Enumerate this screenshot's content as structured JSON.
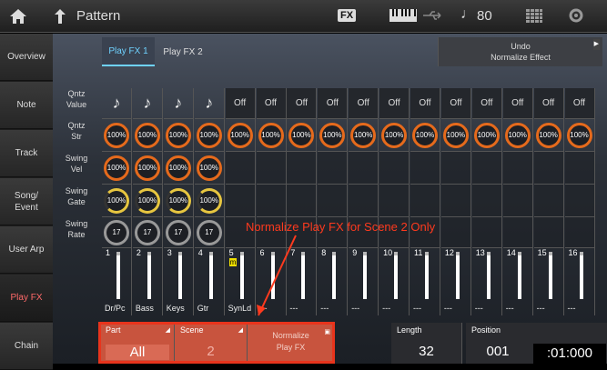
{
  "topbar": {
    "title": "Pattern",
    "fx_badge": "FX",
    "tempo_symbol": "♩",
    "tempo": "80"
  },
  "sidebar": {
    "items": [
      {
        "label": "Overview"
      },
      {
        "label": "Note"
      },
      {
        "label": "Track"
      },
      {
        "label": "Song/\nEvent"
      },
      {
        "label": "User Arp"
      },
      {
        "label": "Play FX",
        "active": true
      },
      {
        "label": "Chain"
      }
    ]
  },
  "tabs": [
    {
      "label": "Play FX 1",
      "active": true
    },
    {
      "label": "Play FX 2"
    }
  ],
  "undo": {
    "line1": "Undo",
    "line2": "Normalize Effect"
  },
  "rows": {
    "qntz_value": "Qntz\nValue",
    "qntz_str": "Qntz\nStr",
    "swing_vel": "Swing\nVel",
    "swing_gate": "Swing\nGate",
    "swing_rate": "Swing\nRate"
  },
  "qntz_value_cells": [
    "♪",
    "♪",
    "♪",
    "♪",
    "Off",
    "Off",
    "Off",
    "Off",
    "Off",
    "Off",
    "Off",
    "Off",
    "Off",
    "Off",
    "Off",
    "Off"
  ],
  "qntz_str_cells": [
    "100%",
    "100%",
    "100%",
    "100%",
    "100%",
    "100%",
    "100%",
    "100%",
    "100%",
    "100%",
    "100%",
    "100%",
    "100%",
    "100%",
    "100%",
    "100%"
  ],
  "swing_vel_cells": [
    "100%",
    "100%",
    "100%",
    "100%"
  ],
  "swing_gate_cells": [
    "100%",
    "100%",
    "100%",
    "100%"
  ],
  "swing_rate_cells": [
    "17",
    "17",
    "17",
    "17"
  ],
  "channels": [
    {
      "num": "1",
      "name": "Dr/Pc"
    },
    {
      "num": "2",
      "name": "Bass"
    },
    {
      "num": "3",
      "name": "Keys"
    },
    {
      "num": "4",
      "name": "Gtr"
    },
    {
      "num": "5",
      "name": "SynLd",
      "badge": "m"
    },
    {
      "num": "6",
      "name": "---"
    },
    {
      "num": "7",
      "name": "---"
    },
    {
      "num": "8",
      "name": "---"
    },
    {
      "num": "9",
      "name": "---"
    },
    {
      "num": "10",
      "name": "---"
    },
    {
      "num": "11",
      "name": "---"
    },
    {
      "num": "12",
      "name": "---"
    },
    {
      "num": "13",
      "name": "---"
    },
    {
      "num": "14",
      "name": "---"
    },
    {
      "num": "15",
      "name": "---"
    },
    {
      "num": "16",
      "name": "---"
    }
  ],
  "bottom": {
    "part_label": "Part",
    "part_value": "All",
    "scene_label": "Scene",
    "scene_value": "2",
    "normalize_line1": "Normalize",
    "normalize_line2": "Play FX",
    "length_label": "Length",
    "length_value": "32",
    "position_label": "Position",
    "position_bar": "001",
    "position_time": ":01:000"
  },
  "annotation": "Normalize Play FX for Scene 2 Only",
  "colors": {
    "accent_red": "#e8341c",
    "active_tab": "#6fd2ff",
    "knob_orange": "#e56a1c"
  }
}
